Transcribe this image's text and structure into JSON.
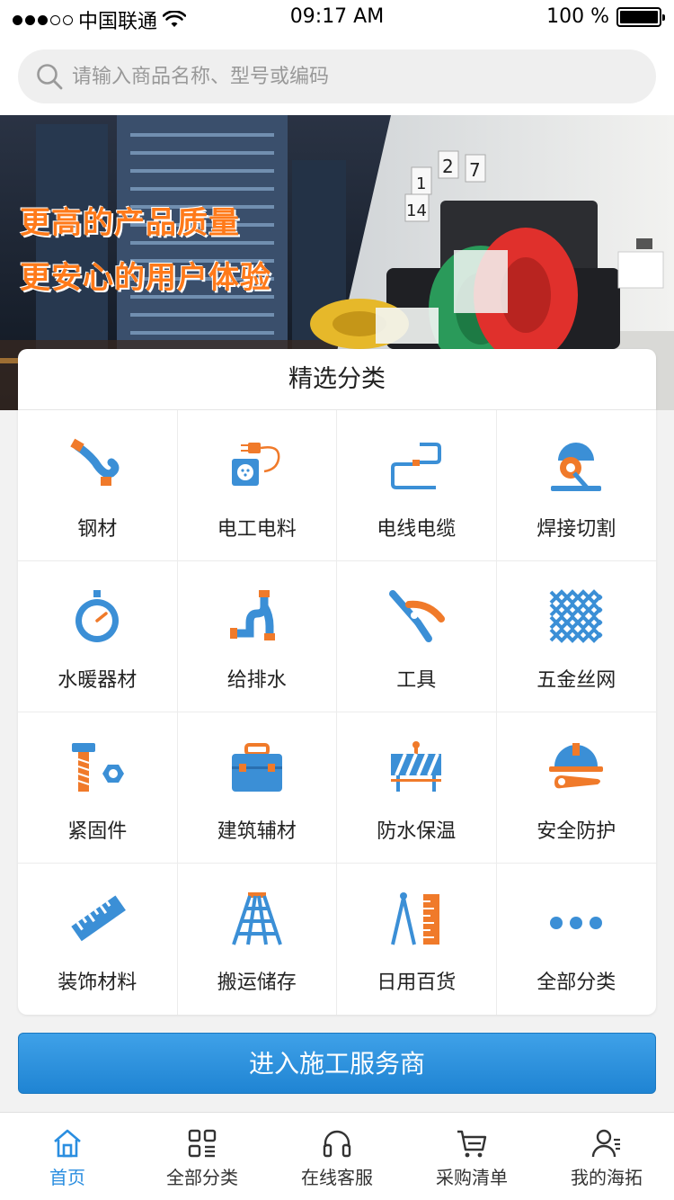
{
  "status_bar": {
    "carrier": "中国联通",
    "time": "09:17 AM",
    "battery": "100 %"
  },
  "search": {
    "placeholder": "请输入商品名称、型号或编码"
  },
  "banner": {
    "line1": "更高的产品质量",
    "line2": "更安心的用户体验",
    "calendar": [
      "1",
      "2",
      "7",
      "14"
    ]
  },
  "categories": {
    "title": "精选分类",
    "items": [
      {
        "label": "钢材",
        "icon": "steel-pipe-icon"
      },
      {
        "label": "电工电料",
        "icon": "socket-plug-icon"
      },
      {
        "label": "电线电缆",
        "icon": "cable-icon"
      },
      {
        "label": "焊接切割",
        "icon": "cutting-machine-icon"
      },
      {
        "label": "水暖器材",
        "icon": "pressure-gauge-icon"
      },
      {
        "label": "给排水",
        "icon": "drain-pipe-icon"
      },
      {
        "label": "工具",
        "icon": "pliers-icon"
      },
      {
        "label": "五金丝网",
        "icon": "wire-mesh-icon"
      },
      {
        "label": "紧固件",
        "icon": "bolt-nut-icon"
      },
      {
        "label": "建筑辅材",
        "icon": "toolbox-icon"
      },
      {
        "label": "防水保温",
        "icon": "barrier-icon"
      },
      {
        "label": "安全防护",
        "icon": "helmet-wrench-icon"
      },
      {
        "label": "装饰材料",
        "icon": "ruler-icon"
      },
      {
        "label": "搬运储存",
        "icon": "ladder-icon"
      },
      {
        "label": "日用百货",
        "icon": "compass-ruler-icon"
      },
      {
        "label": "全部分类",
        "icon": "more-dots-icon"
      }
    ]
  },
  "cta": {
    "label": "进入施工服务商"
  },
  "tabbar": {
    "items": [
      {
        "label": "首页",
        "icon": "home-icon",
        "active": true
      },
      {
        "label": "全部分类",
        "icon": "category-grid-icon",
        "active": false
      },
      {
        "label": "在线客服",
        "icon": "headset-icon",
        "active": false
      },
      {
        "label": "采购清单",
        "icon": "cart-icon",
        "active": false
      },
      {
        "label": "我的海拓",
        "icon": "user-icon",
        "active": false
      }
    ]
  },
  "colors": {
    "accent": "#2a8ee0",
    "orange": "#f07a2a",
    "icon_blue": "#3b8fd6"
  }
}
